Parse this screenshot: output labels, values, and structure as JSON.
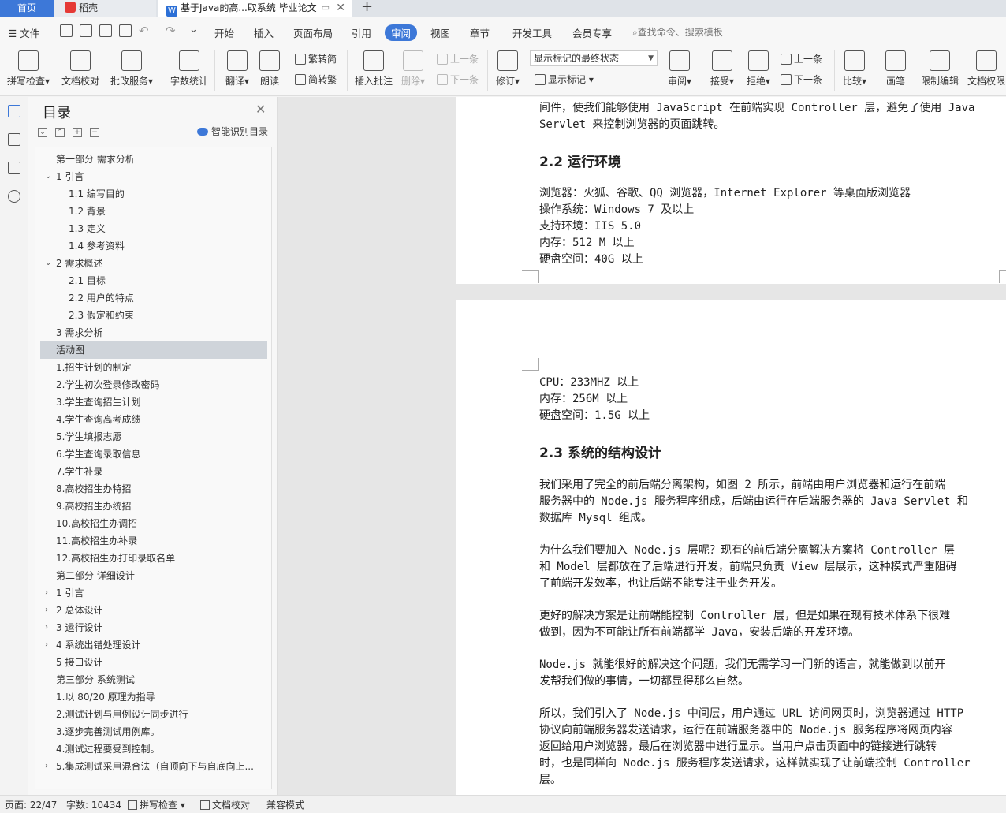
{
  "tabs": {
    "home": "首页",
    "daoke": "稻壳",
    "doc": "基于Java的高...取系统 毕业论文"
  },
  "menu": {
    "file": "文件",
    "items": [
      "开始",
      "插入",
      "页面布局",
      "引用",
      "审阅",
      "视图",
      "章节",
      "开发工具",
      "会员专享"
    ],
    "search": "查找命令、搜索模板"
  },
  "ribbon": {
    "spell_check": "拼写检查",
    "doc_proof": "文档校对",
    "revise_service": "批改服务",
    "word_count": "字数统计",
    "translate": "翻译",
    "read_aloud": "朗读",
    "trad_to_simp": "繁转简",
    "simp_to_trad": "简转繁",
    "insert_comment": "插入批注",
    "delete": "删除",
    "prev_comment": "上一条",
    "next_comment": "下一条",
    "track": "修订",
    "markup_status": "显示标记的最终状态",
    "show_markup": "显示标记",
    "review": "审阅",
    "accept": "接受",
    "reject": "拒绝",
    "prev_change": "上一条",
    "next_change": "下一条",
    "compare": "比较",
    "pen": "画笔",
    "restrict_edit": "限制编辑",
    "doc_permission": "文档权限"
  },
  "toc": {
    "title": "目录",
    "smart": "智能识别目录",
    "items": [
      "第一部分 需求分析",
      "1  引言",
      "1.1  编写目的",
      "1.2 背景",
      "1.3  定义",
      "1.4  参考资料",
      "2  需求概述",
      "2.1 目标",
      "2.2  用户的特点",
      "2.3  假定和约束",
      "3 需求分析",
      "活动图",
      "1.招生计划的制定",
      "2.学生初次登录修改密码",
      "3.学生查询招生计划",
      "4.学生查询高考成绩",
      "5.学生填报志愿",
      "6.学生查询录取信息",
      "7.学生补录",
      "8.高校招生办特招",
      "9.高校招生办统招",
      "10.高校招生办调招",
      "11.高校招生办补录",
      "12.高校招生办打印录取名单",
      "第二部分  详细设计",
      "1 引言",
      "2 总体设计",
      "3 运行设计",
      "4 系统出错处理设计",
      "5 接口设计",
      "第三部分  系统测试",
      "1.以 80/20 原理为指导",
      "2.测试计划与用例设计同步进行",
      "3.逐步完善测试用例库。",
      "4.测试过程要受到控制。",
      "5.集成测试采用混合法（自顶向下与自底向上..."
    ]
  },
  "document": {
    "page1_lines": [
      "间件，使我们能够使用 JavaScript 在前端实现 Controller 层，避免了使用 Java",
      "Servlet 来控制浏览器的页面跳转。"
    ],
    "heading_22": "2.2  运行环境",
    "env_lines": [
      "浏览器：火狐、谷歌、QQ 浏览器，Internet Explorer 等桌面版浏览器",
      "操作系统：Windows 7 及以上",
      "支持环境：IIS 5.0",
      "内存：512 M 以上",
      "硬盘空间：40G 以上"
    ],
    "page2_lines": [
      "CPU：233MHZ 以上",
      "内存：256M 以上",
      "硬盘空间：1.5G 以上"
    ],
    "heading_23": "2.3  系统的结构设计",
    "para1": [
      "我们采用了完全的前后端分离架构，如图 2 所示，前端由用户浏览器和运行在前端",
      "服务器中的 Node.js 服务程序组成，后端由运行在后端服务器的 Java Servlet 和",
      "数据库 Mysql 组成。"
    ],
    "para2": [
      "为什么我们要加入 Node.js 层呢？现有的前后端分离解决方案将 Controller 层",
      "和 Model 层都放在了后端进行开发，前端只负责 View 层展示，这种模式严重阻碍",
      "了前端开发效率，也让后端不能专注于业务开发。"
    ],
    "para3": [
      "更好的解决方案是让前端能控制 Controller 层，但是如果在现有技术体系下很难",
      "做到，因为不可能让所有前端都学 Java，安装后端的开发环境。"
    ],
    "para4": [
      "Node.js 就能很好的解决这个问题，我们无需学习一门新的语言，就能做到以前开",
      "发帮我们做的事情，一切都显得那么自然。"
    ],
    "para5": [
      "所以，我们引入了 Node.js 中间层，用户通过 URL 访问网页时，浏览器通过 HTTP",
      "协议向前端服务器发送请求，运行在前端服务器中的 Node.js 服务程序将网页内容",
      "返回给用户浏览器，最后在浏览器中进行显示。当用户点击页面中的链接进行跳转",
      "时，也是同样向 Node.js 服务程序发送请求，这样就实现了让前端控制 Controller",
      "层。"
    ]
  },
  "status": {
    "page": "页面: 22/47",
    "words": "字数: 10434",
    "spell": "拼写检查",
    "proof": "文档校对",
    "compat": "兼容模式"
  },
  "colors": {
    "accent": "#3d78d8",
    "selected_toc": "#cfd4da"
  }
}
